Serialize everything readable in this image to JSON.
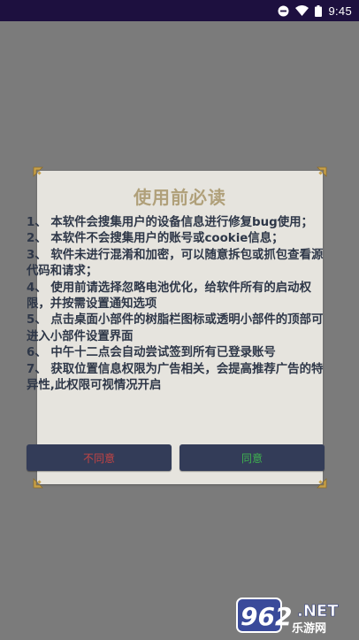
{
  "status_bar": {
    "time": "9:45",
    "icons": [
      "do-not-disturb-icon",
      "wifi-icon",
      "battery-icon"
    ]
  },
  "dialog": {
    "title": "使用前必读",
    "body": "1、 本软件会搜集用户的设备信息进行修复bug使用；\n2、 本软件不会搜集用户的账号或cookie信息；\n3、 软件未进行混淆和加密，可以随意拆包或抓包查看源代码和请求；\n4、 使用前请选择忽略电池优化，给软件所有的启动权限，并按需设置通知选项\n5、 点击桌面小部件的树脂栏图标或透明小部件的顶部可进入小部件设置界面\n6、 中午十二点会自动尝试签到所有已登录账号\n7、 获取位置信息权限为广告相关，会提高推荐广告的特异性,此权限可视情况开启",
    "disagree_label": "不同意",
    "agree_label": "同意"
  },
  "watermark": {
    "brand": "962",
    "suffix": ".NET",
    "subtitle": "乐游网"
  },
  "colors": {
    "overlay": "#7b7b7b",
    "status_bar": "#1d103f",
    "dialog_bg": "#e6e4de",
    "title": "#b0a07a",
    "body_text": "#2e3748",
    "button_bg": "#333c58",
    "disagree_text": "#c44444",
    "agree_text": "#3fb34f",
    "corner_gold": "#c9a24a"
  }
}
